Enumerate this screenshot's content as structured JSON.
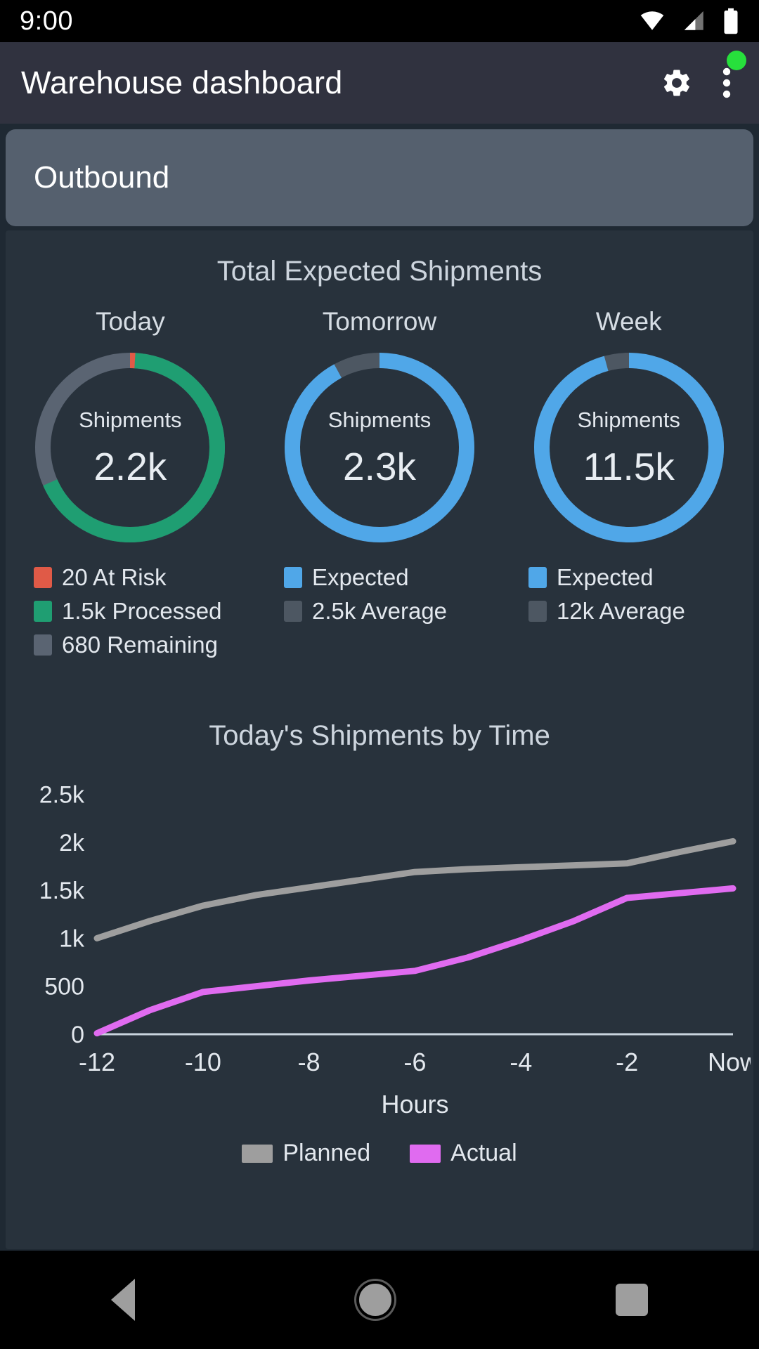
{
  "statusbar": {
    "clock": "9:00",
    "icons": [
      "wifi-icon",
      "cellular-icon",
      "battery-icon"
    ]
  },
  "appbar": {
    "title": "Warehouse dashboard",
    "settings_icon": "gear-icon",
    "overflow_icon": "more-vertical-icon",
    "status_dot_color": "#27e03c"
  },
  "section": {
    "title": "Outbound"
  },
  "shipments_panel": {
    "title": "Total Expected Shipments",
    "cards": [
      {
        "label": "Today",
        "center_caption": "Shipments",
        "center_value": "2.2k",
        "legend": [
          {
            "label": "20 At Risk",
            "color": "#e05a47"
          },
          {
            "label": "1.5k Processed",
            "color": "#1f9e72"
          },
          {
            "label": "680 Remaining",
            "color": "#5a6472"
          }
        ]
      },
      {
        "label": "Tomorrow",
        "center_caption": "Shipments",
        "center_value": "2.3k",
        "legend": [
          {
            "label": "Expected",
            "color": "#50a7e8"
          },
          {
            "label": "2.5k Average",
            "color": "#4d5762"
          }
        ]
      },
      {
        "label": "Week",
        "center_caption": "Shipments",
        "center_value": "11.5k",
        "legend": [
          {
            "label": "Expected",
            "color": "#50a7e8"
          },
          {
            "label": "12k Average",
            "color": "#4d5762"
          }
        ]
      }
    ]
  },
  "chart_data": [
    {
      "type": "pie",
      "title": "Today",
      "center_label": "Shipments",
      "center_value": "2.2k",
      "labels": [
        "20 At Risk",
        "1.5k Processed",
        "680 Remaining"
      ],
      "values": [
        20,
        1500,
        680
      ],
      "colors": [
        "#e05a47",
        "#1f9e72",
        "#5a6472"
      ],
      "donut": true,
      "start_angle_deg": -90
    },
    {
      "type": "pie",
      "title": "Tomorrow",
      "center_label": "Shipments",
      "center_value": "2.3k",
      "labels": [
        "Expected",
        "2.5k Average"
      ],
      "values": [
        2300,
        200
      ],
      "colors": [
        "#50a7e8",
        "#4d5762"
      ],
      "donut": true,
      "start_angle_deg": -90
    },
    {
      "type": "pie",
      "title": "Week",
      "center_label": "Shipments",
      "center_value": "11.5k",
      "labels": [
        "Expected",
        "12k Average"
      ],
      "values": [
        11500,
        500
      ],
      "colors": [
        "#50a7e8",
        "#4d5762"
      ],
      "donut": true,
      "start_angle_deg": -90
    },
    {
      "type": "line",
      "title": "Today's Shipments by Time",
      "xlabel": "Hours",
      "ylabel": "",
      "x": [
        -12,
        -11,
        -10,
        -9,
        -8,
        -7,
        -6,
        -5,
        -4,
        -3,
        -2,
        -1,
        0
      ],
      "xtick_labels": [
        "-12",
        "-10",
        "-8",
        "-6",
        "-4",
        "-2",
        "Now"
      ],
      "xtick_values": [
        -12,
        -10,
        -8,
        -6,
        -4,
        -2,
        0
      ],
      "ytick_labels": [
        "0",
        "500",
        "1k",
        "1.5k",
        "2k",
        "2.5k"
      ],
      "ytick_values": [
        0,
        500,
        1000,
        1500,
        2000,
        2500
      ],
      "ylim": [
        0,
        2650
      ],
      "xlim": [
        -12,
        0
      ],
      "grid": false,
      "legend_position": "bottom",
      "series": [
        {
          "name": "Planned",
          "color": "#9e9e9e",
          "values": [
            1000,
            1180,
            1340,
            1450,
            1530,
            1610,
            1690,
            1720,
            1740,
            1760,
            1780,
            1900,
            2010
          ]
        },
        {
          "name": "Actual",
          "color": "#e06bf0",
          "values": [
            10,
            250,
            440,
            500,
            560,
            610,
            660,
            800,
            980,
            1180,
            1420,
            1470,
            1520
          ]
        }
      ]
    }
  ],
  "chart_legend": [
    {
      "label": "Planned",
      "color": "#9e9e9e"
    },
    {
      "label": "Actual",
      "color": "#e06bf0"
    }
  ],
  "navbar": {
    "back": "back-triangle-icon",
    "home": "home-circle-icon",
    "recents": "recents-square-icon"
  }
}
